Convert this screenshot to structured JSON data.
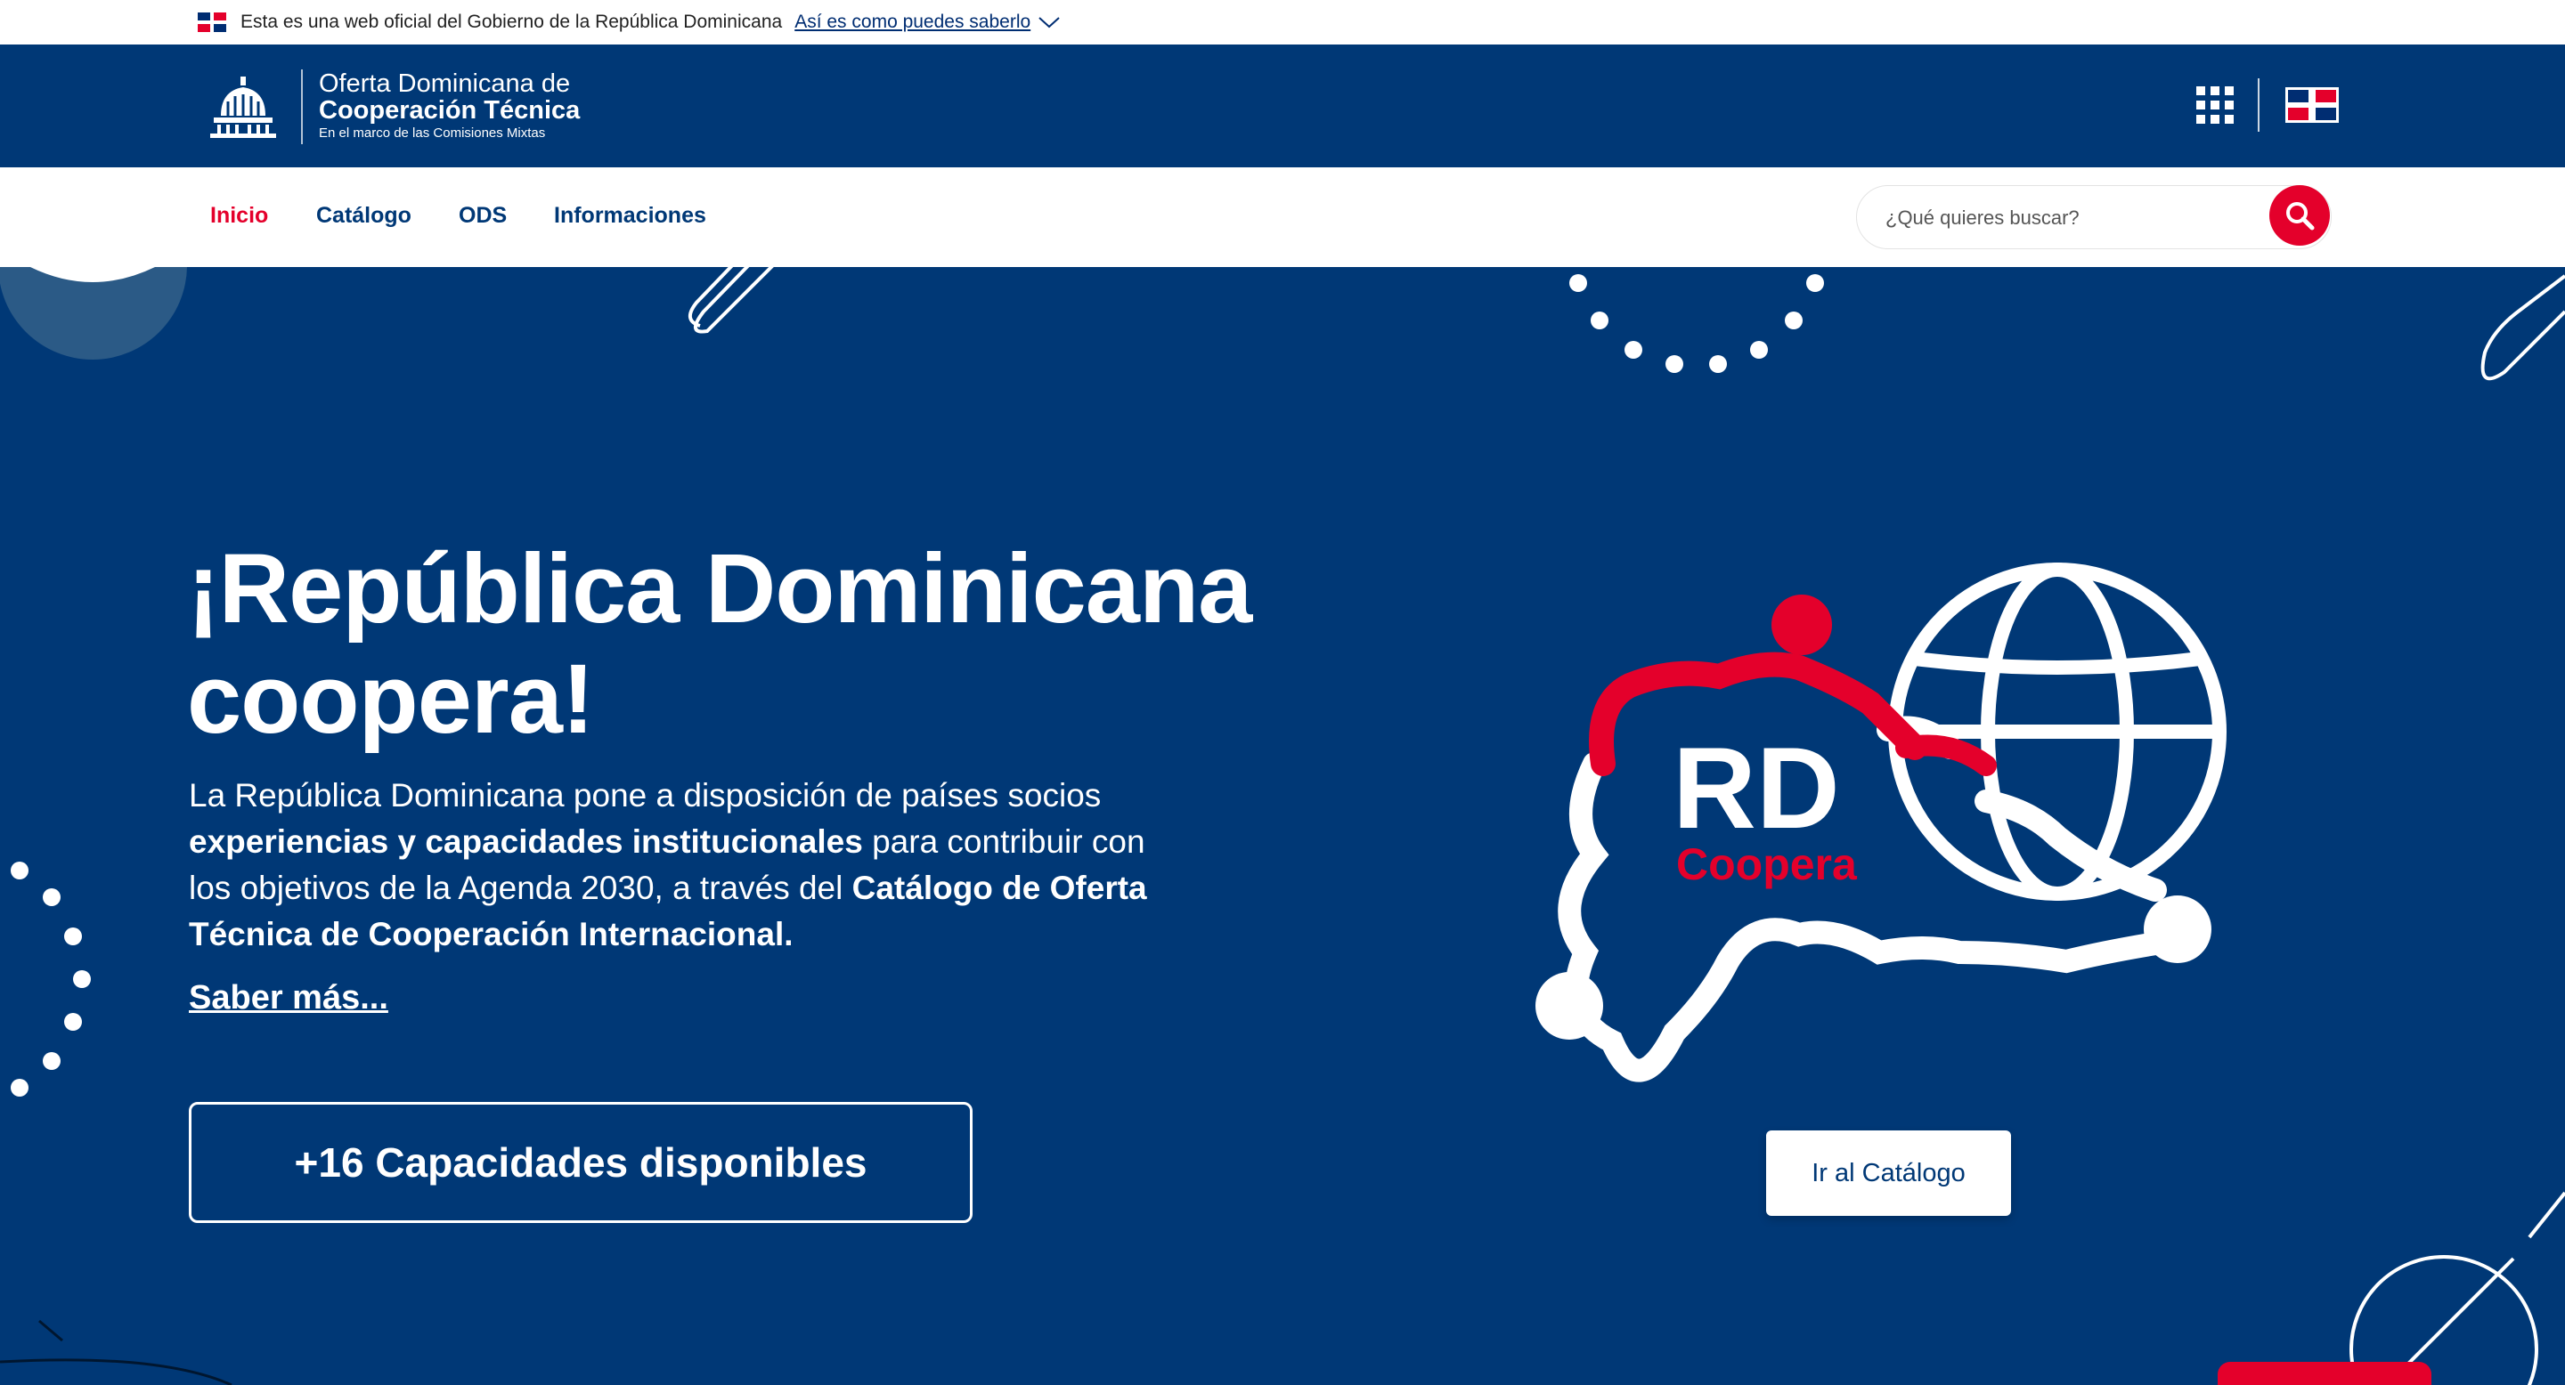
{
  "gov_bar": {
    "text": "Esta es una web oficial del Gobierno de la República Dominicana",
    "link": "Así es como puedes saberlo"
  },
  "header": {
    "logo_line1": "Oferta Dominicana de",
    "logo_line2": "Cooperación Técnica",
    "logo_line3": "En el marco de las Comisiones Mixtas",
    "icons": [
      "apps-grid-icon",
      "dominican-flag-icon"
    ]
  },
  "nav": {
    "items": [
      {
        "label": "Inicio",
        "active": true
      },
      {
        "label": "Catálogo",
        "active": false
      },
      {
        "label": "ODS",
        "active": false
      },
      {
        "label": "Informaciones",
        "active": false
      }
    ],
    "search_placeholder": "¿Qué quieres buscar?"
  },
  "hero": {
    "title_line1": "¡República Dominicana",
    "title_line2": "coopera!",
    "desc_part1": "La República Dominicana pone a disposición de países socios ",
    "desc_bold1": "experiencias y capacidades institucionales",
    "desc_part2": " para contribuir con los objetivos de la Agenda 2030, a través del ",
    "desc_bold2": "Catálogo de Oferta Técnica de Cooperación Internacional.",
    "saber_mas": "Saber más...",
    "capacidades_button": "+16 Capacidades disponibles",
    "catalog_button": "Ir al Catálogo",
    "logo_rd": "RD",
    "logo_coopera": "Coopera"
  },
  "colors": {
    "primary_blue": "#003876",
    "accent_red": "#e4002b",
    "white": "#ffffff"
  }
}
